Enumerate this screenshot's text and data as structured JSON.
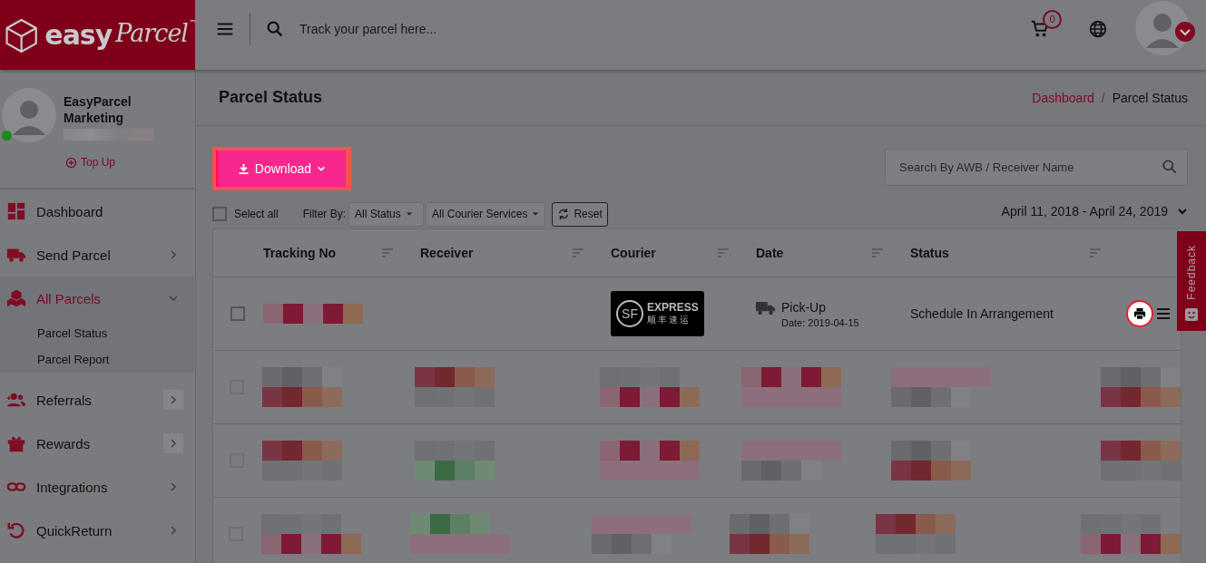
{
  "logo": {
    "brand": "easy",
    "script": "Parcel",
    "mark": "™"
  },
  "topbar": {
    "search_placeholder": "Track your parcel here...",
    "cart_count": "0"
  },
  "user": {
    "name": "EasyParcel Marketing",
    "online": true,
    "top_up": "Top Up"
  },
  "nav": [
    {
      "label": "Dashboard",
      "selected": false
    },
    {
      "label": "Send Parcel",
      "expanded": false,
      "selected": false
    },
    {
      "label": "All Parcels",
      "expanded": true,
      "selected": true,
      "children": [
        {
          "label": "Parcel Status"
        },
        {
          "label": "Parcel Report"
        }
      ]
    },
    {
      "label": "Referrals",
      "expanded": false,
      "selected": false
    },
    {
      "label": "Rewards",
      "expanded": false,
      "selected": false
    },
    {
      "label": "Integrations",
      "expanded": false,
      "selected": false
    },
    {
      "label": "QuickReturn",
      "expanded": false,
      "selected": false
    }
  ],
  "page": {
    "title": "Parcel Status",
    "breadcrumb_separator": "/",
    "breadcrumbs": [
      {
        "label": "Dashboard",
        "link": true
      },
      {
        "label": "Parcel Status",
        "link": false
      }
    ]
  },
  "toolbar": {
    "download": "Download",
    "search_placeholder": "Search By AWB / Receiver Name",
    "select_all": "Select all",
    "select_all_checked": false,
    "filter_label": "Filter By:",
    "filters": [
      "All Status",
      "All Courier Services"
    ],
    "reset": "Reset",
    "date_range": "April 11, 2018 - April 24, 2019"
  },
  "table": {
    "columns": [
      "Tracking No",
      "Receiver",
      "Courier",
      "Date",
      "Status"
    ],
    "rows": [
      {
        "kind": "parcel",
        "selected": false,
        "courier": {
          "mark": "SF",
          "name": "EXPRESS",
          "name_cn": "顺丰速运"
        },
        "event": "Pick-Up",
        "date": "Date: 2019-04-15",
        "status": "Schedule In Arrangement"
      },
      {
        "kind": "blurred",
        "selected": false
      },
      {
        "kind": "blurred",
        "selected": false
      },
      {
        "kind": "blurred",
        "selected": false
      }
    ]
  },
  "feedback": "Feedback"
}
